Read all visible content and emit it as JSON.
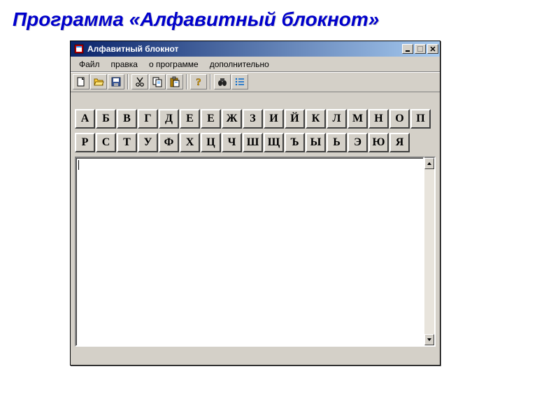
{
  "page_heading": "Программа «Алфавитный блокнот»",
  "window": {
    "title": "Алфавитный блокнот"
  },
  "menu": {
    "file": "Файл",
    "edit": "правка",
    "about": "о программе",
    "extra": "дополнительно"
  },
  "toolbar": {
    "new": "new",
    "open": "open",
    "save": "save",
    "cut": "cut",
    "copy": "copy",
    "paste": "paste",
    "help": "help",
    "find": "find",
    "sort": "sort"
  },
  "alphabet": {
    "row1": [
      "А",
      "Б",
      "В",
      "Г",
      "Д",
      "Е",
      "Е",
      "Ж",
      "З",
      "И",
      "Й",
      "К",
      "Л",
      "М",
      "Н",
      "О",
      "П"
    ],
    "row2": [
      "Р",
      "С",
      "Т",
      "У",
      "Ф",
      "Х",
      "Ц",
      "Ч",
      "Ш",
      "Щ",
      "Ъ",
      "Ы",
      "Ь",
      "Э",
      "Ю",
      "Я"
    ]
  },
  "editor": {
    "content": ""
  }
}
